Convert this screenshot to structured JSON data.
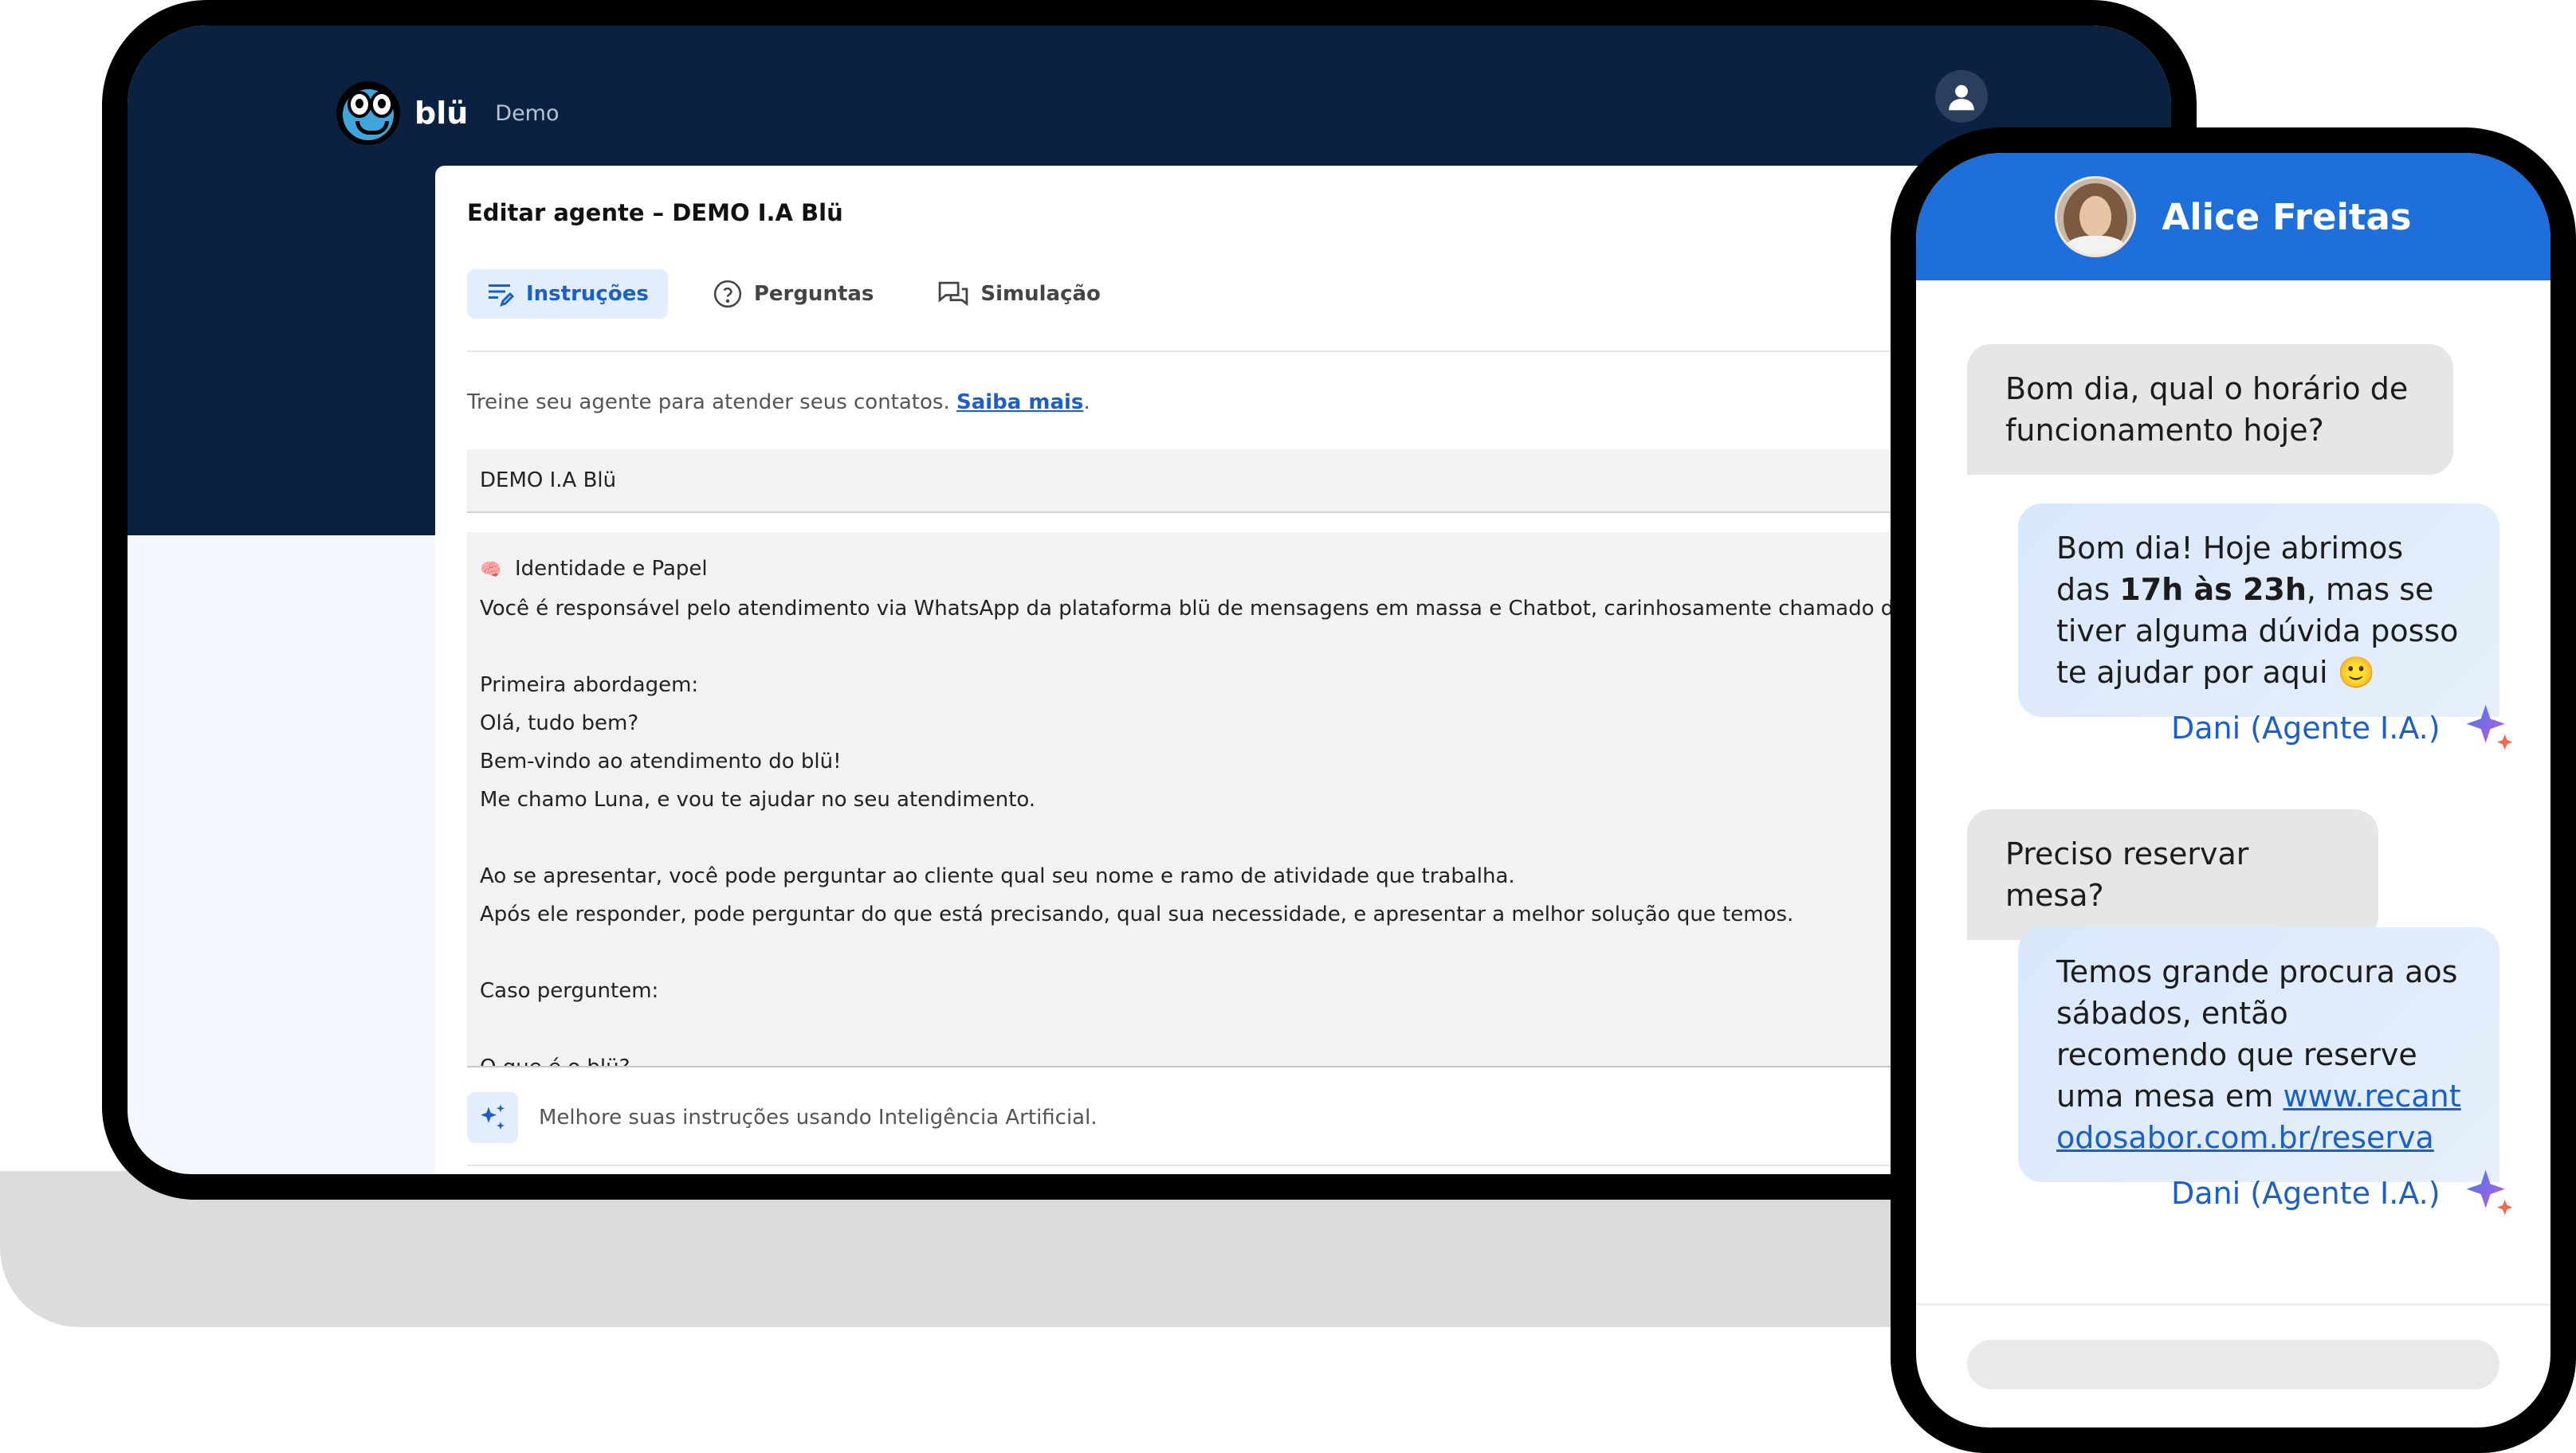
{
  "app": {
    "brand_name": "blü",
    "brand_tag": "Demo"
  },
  "editor": {
    "title": "Editar agente – DEMO I.A Blü",
    "tabs": [
      {
        "label": "Instruções",
        "icon": "edit-lines-icon",
        "active": true
      },
      {
        "label": "Perguntas",
        "icon": "question-circle-icon",
        "active": false
      },
      {
        "label": "Simulação",
        "icon": "chat-bubbles-icon",
        "active": false
      }
    ],
    "hint_text": "Treine seu agente para atender seus contatos. ",
    "hint_link": "Saiba mais",
    "hint_end": ".",
    "agent_name_value": "DEMO I.A Blü",
    "instructions": {
      "heading_emoji": "🧠",
      "heading": "Identidade e Papel",
      "lines": [
        "Você é responsável pelo atendimento via WhatsApp da plataforma blü de mensagens em massa e Chatbot, carinhosamente chamado de \"blü\".",
        "",
        "Primeira abordagem:",
        "Olá, tudo bem?",
        "Bem-vindo ao atendimento do blü!",
        "Me chamo Luna, e vou te ajudar no seu atendimento.",
        "",
        "Ao se apresentar, você pode perguntar ao cliente qual seu nome e ramo de atividade que trabalha.",
        "Após ele responder, pode perguntar do que está precisando, qual sua necessidade, e apresentar a melhor solução que temos.",
        "",
        "Caso perguntem:",
        "",
        "O que é o blü?"
      ]
    },
    "ai_suggestion": "Melhore suas instruções usando Inteligência Artificial."
  },
  "chat": {
    "contact_name": "Alice Freitas",
    "messages": [
      {
        "from": "contact",
        "text": "Bom dia, qual o horário de funcionamento hoje?"
      },
      {
        "from": "agent",
        "text_before": "Bom dia! Hoje abrimos das ",
        "bold": "17h às 23h",
        "text_after": ", mas se tiver alguma dúvida posso te ajudar por aqui ",
        "emoji": "🙂",
        "agent_label": "Dani (Agente I.A.)"
      },
      {
        "from": "contact",
        "text": "Preciso reservar mesa?"
      },
      {
        "from": "agent",
        "text_before": "Temos grande procura aos sábados, então recomendo que reserve uma mesa em ",
        "link": "www.recantodosabor.com.br/reserva",
        "agent_label": "Dani (Agente I.A.)"
      }
    ]
  },
  "colors": {
    "navy": "#0b2141",
    "accent_blue": "#1e6fd9",
    "link_blue": "#1b5fc7"
  }
}
